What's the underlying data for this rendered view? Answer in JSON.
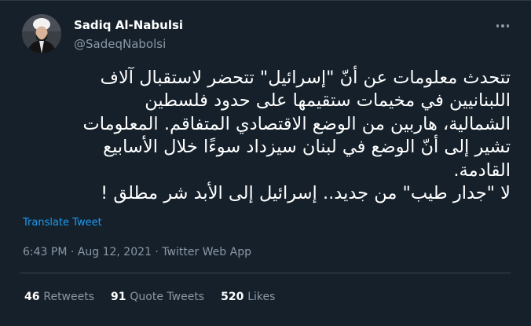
{
  "tweet": {
    "author_name": "Sadiq Al-Nabulsi",
    "author_handle": "@SadeqNabolsi",
    "avatar_icon": "profile-photo",
    "more_icon": "more-options-icon",
    "text_lines": [
      "تتحدث معلومات عن أنّ \"إسرائيل\" تتحضر لاستقبال آلاف",
      "اللبنانيين في مخيمات ستقيمها على حدود فلسطين",
      "الشمالية، هاربين من الوضع الاقتصادي المتفاقم. المعلومات",
      "تشير إلى أنّ الوضع في لبنان سيزداد سوءًا خلال الأسابيع",
      "القادمة.",
      "لا \"جدار طيب\" من جديد.. إسرائيل إلى الأبد شر مطلق !"
    ],
    "translate_label": "Translate Tweet",
    "time": "6:43 PM",
    "date": "Aug 12, 2021",
    "source": "Twitter Web App",
    "separator": "·"
  },
  "stats": {
    "retweets_count": "46",
    "retweets_label": "Retweets",
    "quote_count": "91",
    "quote_label": "Quote Tweets",
    "likes_count": "520",
    "likes_label": "Likes"
  },
  "colors": {
    "background": "#15202b",
    "text": "#ffffff",
    "secondary": "#8b98a5",
    "link": "#1d9bf0"
  }
}
